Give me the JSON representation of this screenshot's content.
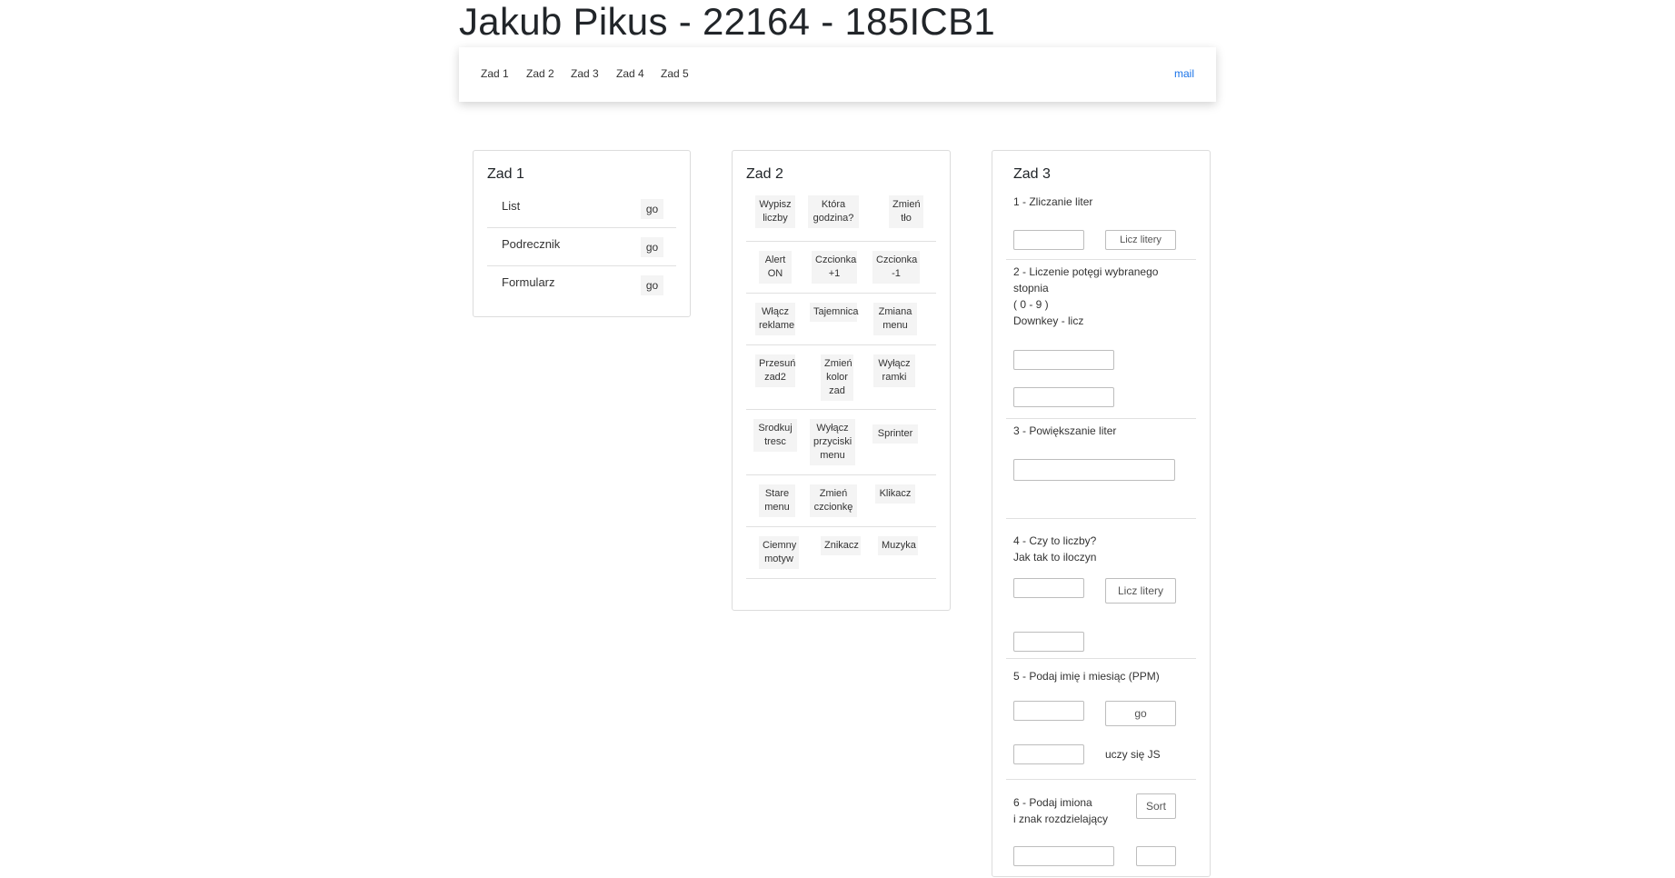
{
  "header": {
    "title": "Jakub Pikus - 22164 - 185ICB1"
  },
  "nav": {
    "items": [
      "Zad 1",
      "Zad 2",
      "Zad 3",
      "Zad 4",
      "Zad 5"
    ],
    "mail": "mail"
  },
  "card1": {
    "title": "Zad 1",
    "rows": [
      {
        "label": "List",
        "button": "go"
      },
      {
        "label": "Podrecznik",
        "button": "go"
      },
      {
        "label": "Formularz",
        "button": "go"
      }
    ]
  },
  "card2": {
    "title": "Zad 2",
    "rows": [
      [
        "Wypisz liczby",
        "Która godzina?",
        "Zmień tło"
      ],
      [
        "Alert ON",
        "Czcionka +1",
        "Czcionka -1"
      ],
      [
        "Włącz reklame",
        "Tajemnica",
        "Zmiana menu"
      ],
      [
        "Przesuń zad2",
        "Zmień kolor zad",
        "Wyłącz ramki"
      ],
      [
        "Srodkuj tresc",
        "Wyłącz przyciski menu",
        "Sprinter"
      ],
      [
        "Stare menu",
        "Zmień czcionkę",
        "Klikacz"
      ],
      [
        "Ciemny motyw",
        "Znikacz",
        "Muzyka"
      ]
    ]
  },
  "card3": {
    "title": "Zad 3",
    "s1": {
      "label": "1 - Zliczanie liter",
      "button": "Licz litery"
    },
    "s2": {
      "line1": "2 - Liczenie potęgi wybranego",
      "line2": "stopnia",
      "line3": "( 0 - 9 )",
      "line4": "Downkey - licz"
    },
    "s3": {
      "label": "3 - Powiększanie liter"
    },
    "s4": {
      "line1": "4 - Czy to liczby?",
      "line2": "Jak tak to iloczyn",
      "button": "Licz litery"
    },
    "s5": {
      "label": "5 - Podaj imię i miesiąc (PPM)",
      "button": "go",
      "result": "uczy się JS"
    },
    "s6": {
      "line1": "6 - Podaj imiona",
      "line2": "i znak rozdzielający",
      "button": "Sort"
    }
  }
}
